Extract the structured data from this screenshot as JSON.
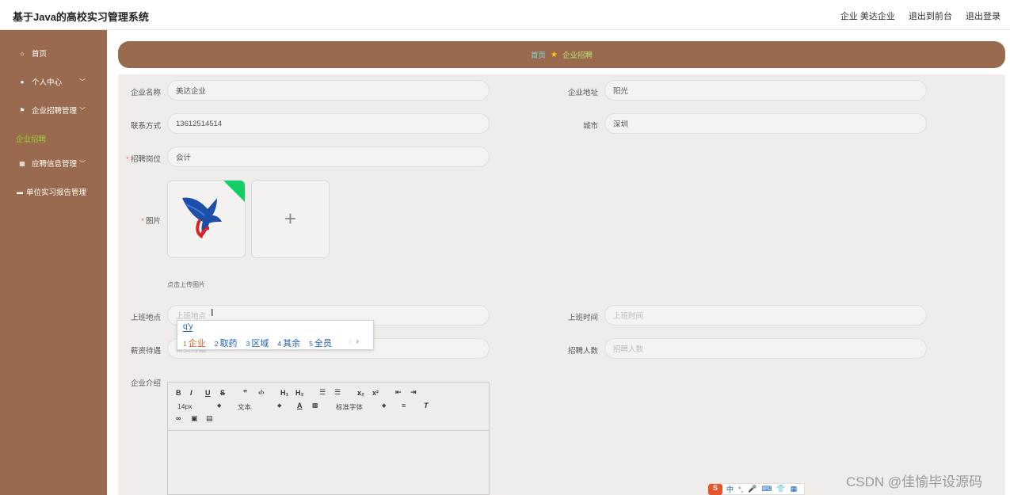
{
  "header": {
    "title": "基于Java的高校实习管理系统",
    "user": "企业 美达企业",
    "to_front": "退出到前台",
    "logout": "退出登录"
  },
  "sidebar": {
    "items": [
      {
        "label": "首页"
      },
      {
        "label": "个人中心"
      },
      {
        "label": "企业招聘管理"
      },
      {
        "label": "应聘信息管理"
      },
      {
        "label": "单位实习报告管理"
      }
    ],
    "sub_item": "企业招聘"
  },
  "breadcrumb": {
    "home": "首页",
    "current": "企业招聘"
  },
  "form": {
    "company_name": {
      "label": "企业名称",
      "value": "美达企业"
    },
    "company_address": {
      "label": "企业地址",
      "value": "阳光"
    },
    "contact": {
      "label": "联系方式",
      "value": "13612514514"
    },
    "city": {
      "label": "城市",
      "value": "深圳"
    },
    "position": {
      "label": "招聘岗位",
      "value": "会计"
    },
    "image": {
      "label": "图片",
      "tip": "点击上传图片"
    },
    "work_place": {
      "label": "上班地点",
      "placeholder": "上班地点"
    },
    "work_time": {
      "label": "上班时间",
      "placeholder": "上班时间"
    },
    "salary": {
      "label": "薪资待遇",
      "placeholder": "薪资待遇"
    },
    "headcount": {
      "label": "招聘人数",
      "placeholder": "招聘人数"
    },
    "intro": {
      "label": "企业介绍"
    }
  },
  "editor": {
    "size": "14px",
    "header": "文本",
    "font": "标准字体"
  },
  "ime": {
    "typed": "q'y",
    "candidates": [
      {
        "n": "1",
        "text": "企业"
      },
      {
        "n": "2",
        "text": "取药"
      },
      {
        "n": "3",
        "text": "区域"
      },
      {
        "n": "4",
        "text": "其余"
      },
      {
        "n": "5",
        "text": "全员"
      }
    ],
    "status": [
      "中",
      "°,",
      "🎤",
      "⌨",
      "👕",
      "▦"
    ]
  },
  "watermark": "CSDN @佳愉毕设源码",
  "colors": {
    "sidebar": "#9a6a4f",
    "accent_green": "#9acd32",
    "required": "#f56c6c"
  }
}
